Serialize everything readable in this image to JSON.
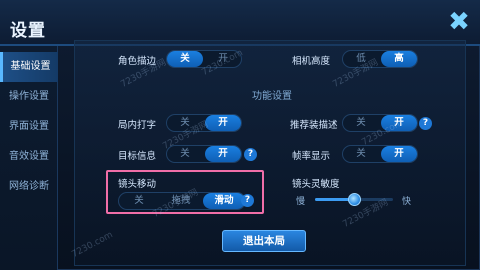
{
  "header": {
    "title": "设置",
    "close_icon": "close-x-icon"
  },
  "sidebar": {
    "items": [
      {
        "label": "基础设置",
        "active": true
      },
      {
        "label": "操作设置"
      },
      {
        "label": "界面设置"
      },
      {
        "label": "音效设置"
      },
      {
        "label": "网络诊断"
      }
    ]
  },
  "settings": {
    "camera_tilt": {
      "label": "角色描边",
      "options": [
        "关",
        "开"
      ],
      "selected": "关"
    },
    "camera_height": {
      "label": "相机高度",
      "options": [
        "低",
        "高"
      ],
      "selected": "高"
    },
    "section_title": "功能设置",
    "ingame_typing": {
      "label": "局内打字",
      "options": [
        "关",
        "开"
      ],
      "selected": "开"
    },
    "recommend_desc": {
      "label": "推荐装描述",
      "options": [
        "关",
        "开"
      ],
      "selected": "开"
    },
    "target_info": {
      "label": "目标信息",
      "options": [
        "关",
        "开"
      ],
      "selected": "开"
    },
    "frame_rate": {
      "label": "帧率显示",
      "options": [
        "关",
        "开"
      ],
      "selected": "开"
    },
    "camera_move": {
      "label": "镜头移动",
      "options": [
        "关",
        "拖拽",
        "滑动"
      ],
      "selected": "滑动"
    },
    "camera_sensitivity": {
      "label": "镜头灵敏度",
      "min_label": "慢",
      "max_label": "快",
      "value": 0.5
    }
  },
  "footer": {
    "exit_label": "退出本局"
  },
  "watermarks": [
    "7230手游网",
    "7230.com"
  ],
  "colors": {
    "accent": "#1a7fe0",
    "highlight": "#f06ea8"
  }
}
